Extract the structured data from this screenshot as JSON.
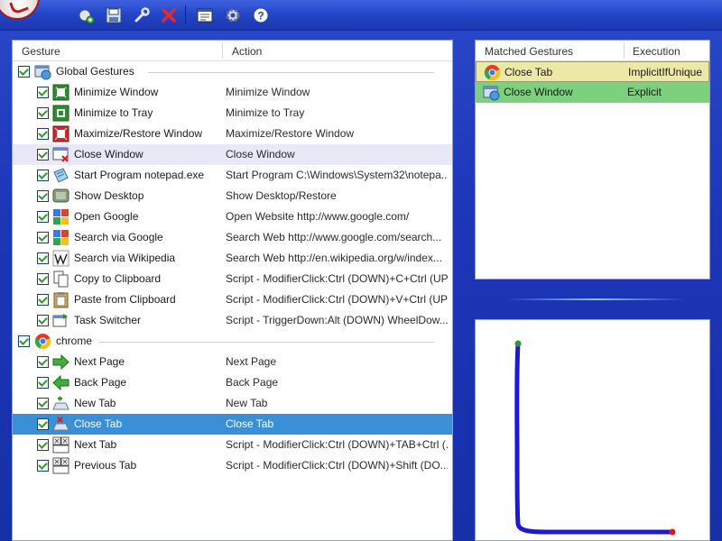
{
  "toolbar": {
    "buttons": [
      {
        "name": "add-gesture-icon"
      },
      {
        "name": "save-icon"
      },
      {
        "name": "wrench-icon"
      },
      {
        "name": "delete-icon"
      },
      {
        "name": "window-icon"
      },
      {
        "name": "gear-icon"
      },
      {
        "name": "help-icon"
      }
    ]
  },
  "gestures": {
    "col_gesture": "Gesture",
    "col_action": "Action",
    "groups": [
      {
        "name": "Global Gestures",
        "icon": "global-gestures-icon",
        "items": [
          {
            "name": "Minimize Window",
            "action": "Minimize Window",
            "icon": "minimize-window-icon"
          },
          {
            "name": "Minimize to Tray",
            "action": "Minimize to Tray",
            "icon": "minimize-tray-icon"
          },
          {
            "name": "Maximize/Restore Window",
            "action": "Maximize/Restore Window",
            "icon": "maximize-icon"
          },
          {
            "name": "Close Window",
            "action": "Close Window",
            "icon": "close-window-icon"
          },
          {
            "name": "Start Program notepad.exe",
            "action": "Start Program C:\\Windows\\System32\\notepa...",
            "icon": "notepad-icon"
          },
          {
            "name": "Show Desktop",
            "action": "Show Desktop/Restore",
            "icon": "desktop-icon"
          },
          {
            "name": "Open Google",
            "action": "Open Website http://www.google.com/",
            "icon": "google-icon"
          },
          {
            "name": "Search via Google",
            "action": "Search Web http://www.google.com/search...",
            "icon": "google-search-icon"
          },
          {
            "name": "Search via Wikipedia",
            "action": "Search Web http://en.wikipedia.org/w/index...",
            "icon": "wikipedia-icon"
          },
          {
            "name": "Copy to Clipboard",
            "action": "Script - ModifierClick:Ctrl (DOWN)+C+Ctrl (UP)",
            "icon": "copy-icon"
          },
          {
            "name": "Paste from Clipboard",
            "action": "Script - ModifierClick:Ctrl (DOWN)+V+Ctrl (UP)",
            "icon": "paste-icon"
          },
          {
            "name": "Task Switcher",
            "action": "Script - TriggerDown:Alt (DOWN) WheelDow...",
            "icon": "task-switcher-icon"
          }
        ]
      },
      {
        "name": "chrome",
        "icon": "chrome-icon",
        "items": [
          {
            "name": "Next Page",
            "action": "Next Page",
            "icon": "arrow-right-icon"
          },
          {
            "name": "Back Page",
            "action": "Back Page",
            "icon": "arrow-left-icon"
          },
          {
            "name": "New Tab",
            "action": "New Tab",
            "icon": "new-tab-icon"
          },
          {
            "name": "Close Tab",
            "action": "Close Tab",
            "icon": "close-tab-icon"
          },
          {
            "name": "Next Tab",
            "action": "Script - ModifierClick:Ctrl (DOWN)+TAB+Ctrl (...",
            "icon": "next-tab-icon"
          },
          {
            "name": "Previous Tab",
            "action": "Script - ModifierClick:Ctrl (DOWN)+Shift (DO...",
            "icon": "previous-tab-icon"
          }
        ]
      }
    ]
  },
  "matched": {
    "col_name": "Matched Gestures",
    "col_exec": "Execution",
    "rows": [
      {
        "name": "Close Tab",
        "execution": "ImplicitIfUnique",
        "icon": "chrome-icon"
      },
      {
        "name": "Close Window",
        "execution": "Explicit",
        "icon": "global-gestures-icon"
      }
    ]
  },
  "colors": {
    "selected_row": "#3a8fd6",
    "match_implicit": "#ece8a6",
    "match_explicit": "#7dd07d",
    "stroke": "#1a1ad8",
    "stroke_start": "#2a9a2a",
    "stroke_end": "#d81a1a"
  }
}
